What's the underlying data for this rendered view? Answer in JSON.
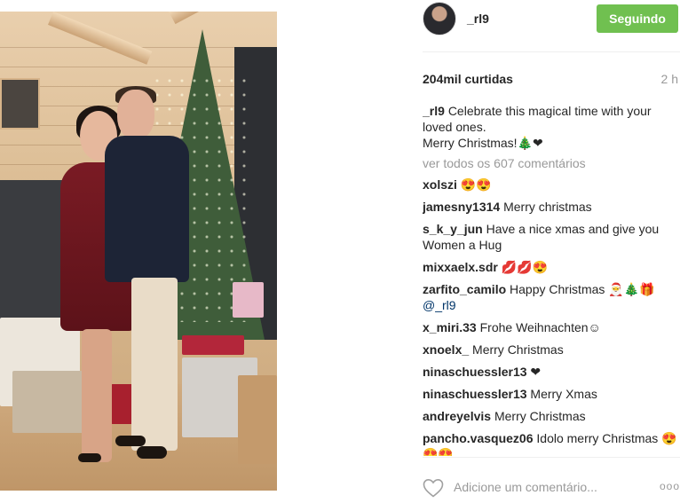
{
  "post": {
    "username": "_rl9",
    "follow_label": "Seguindo",
    "likes": "204mil curtidas",
    "time": "2 h",
    "caption": {
      "user": "_rl9",
      "text": "Celebrate this magical time with your loved ones.",
      "text2": "Merry Christmas!🎄❤"
    },
    "view_all": "ver todos os 607 comentários",
    "comments": [
      {
        "user": "xolszi",
        "text": "😍😍"
      },
      {
        "user": "jamesny1314",
        "text": "Merry christmas"
      },
      {
        "user": "s_k_y_jun",
        "text": "Have a nice xmas and give you Women a Hug"
      },
      {
        "user": "mixxaelx.sdr",
        "text": "💋💋😍"
      },
      {
        "user": "zarfito_camilo",
        "text": "Happy Christmas 🎅🎄🎁",
        "mention": "@_rl9"
      },
      {
        "user": "x_miri.33",
        "text": "Frohe Weihnachten☺"
      },
      {
        "user": "xnoelx_",
        "text": "Merry Christmas"
      },
      {
        "user": "ninaschuessler13",
        "text": "❤"
      },
      {
        "user": "ninaschuessler13",
        "text": "Merry Xmas"
      },
      {
        "user": "andreyelvis",
        "text": "Merry Christmas"
      },
      {
        "user": "pancho.vasquez06",
        "text": "Idolo merry Christmas 😍😍😍"
      }
    ],
    "comment_placeholder": "Adicione um comentário...",
    "more_label": "ooo"
  },
  "colors": {
    "follow_button": "#70c050",
    "mention": "#003569",
    "muted": "#999999"
  },
  "icons": {
    "like": "heart-icon",
    "more": "more-options-icon"
  }
}
